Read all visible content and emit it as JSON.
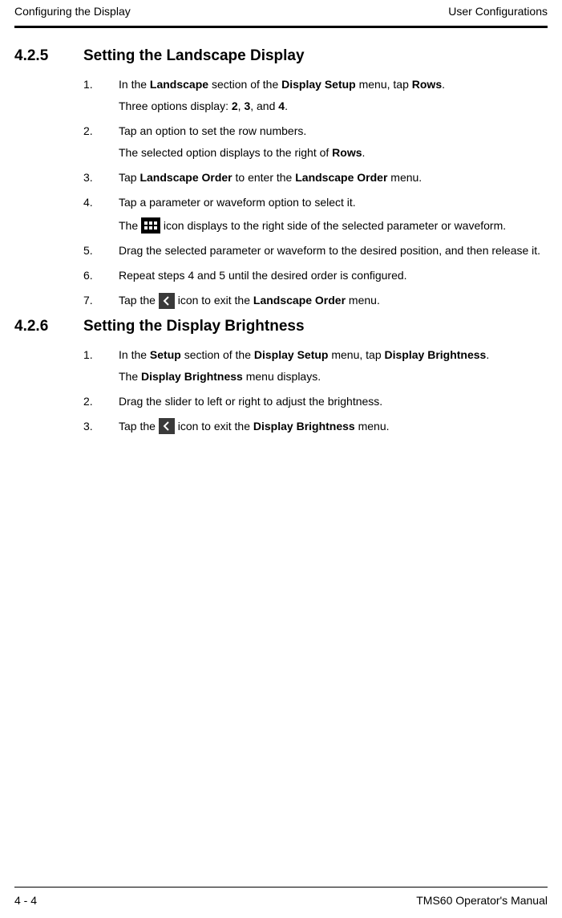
{
  "header": {
    "left": "Configuring the Display",
    "right": "User Configurations"
  },
  "section425": {
    "num": "4.2.5",
    "title": "Setting the Landscape Display",
    "steps": {
      "s1": {
        "n": "1.",
        "p1a": "In the ",
        "p1b": "Landscape",
        "p1c": " section of the ",
        "p1d": "Display Setup",
        "p1e": " menu, tap ",
        "p1f": "Rows",
        "p1g": ".",
        "p2a": "Three options display: ",
        "p2b": "2",
        "p2c": ", ",
        "p2d": "3",
        "p2e": ", and ",
        "p2f": "4",
        "p2g": "."
      },
      "s2": {
        "n": "2.",
        "p1": "Tap an option to set the row numbers.",
        "p2a": "The selected option displays to the right of ",
        "p2b": "Rows",
        "p2c": "."
      },
      "s3": {
        "n": "3.",
        "p1a": "Tap ",
        "p1b": "Landscape Order",
        "p1c": " to enter the ",
        "p1d": "Landscape Order",
        "p1e": " menu."
      },
      "s4": {
        "n": "4.",
        "p1": "Tap a parameter or waveform option to select it.",
        "p2a": "The ",
        "p2b": " icon displays to the right side of the selected parameter or waveform."
      },
      "s5": {
        "n": "5.",
        "p1": "Drag the selected parameter or waveform to the desired position, and then release it."
      },
      "s6": {
        "n": "6.",
        "p1": "Repeat steps 4 and 5 until the desired order is configured."
      },
      "s7": {
        "n": "7.",
        "p1a": "Tap the ",
        "p1b": " icon to exit the ",
        "p1c": "Landscape Order",
        "p1d": " menu."
      }
    }
  },
  "section426": {
    "num": "4.2.6",
    "title": "Setting the Display Brightness",
    "steps": {
      "s1": {
        "n": "1.",
        "p1a": "In the ",
        "p1b": "Setup",
        "p1c": " section of the ",
        "p1d": "Display Setup",
        "p1e": " menu, tap ",
        "p1f": "Display Brightness",
        "p1g": ".",
        "p2a": "The ",
        "p2b": "Display Brightness",
        "p2c": " menu displays."
      },
      "s2": {
        "n": "2.",
        "p1": "Drag the slider to left or right to adjust the brightness."
      },
      "s3": {
        "n": "3.",
        "p1a": "Tap the ",
        "p1b": " icon to exit the ",
        "p1c": "Display Brightness",
        "p1d": " menu."
      }
    }
  },
  "footer": {
    "left": "4 - 4",
    "right": "TMS60 Operator's Manual"
  }
}
